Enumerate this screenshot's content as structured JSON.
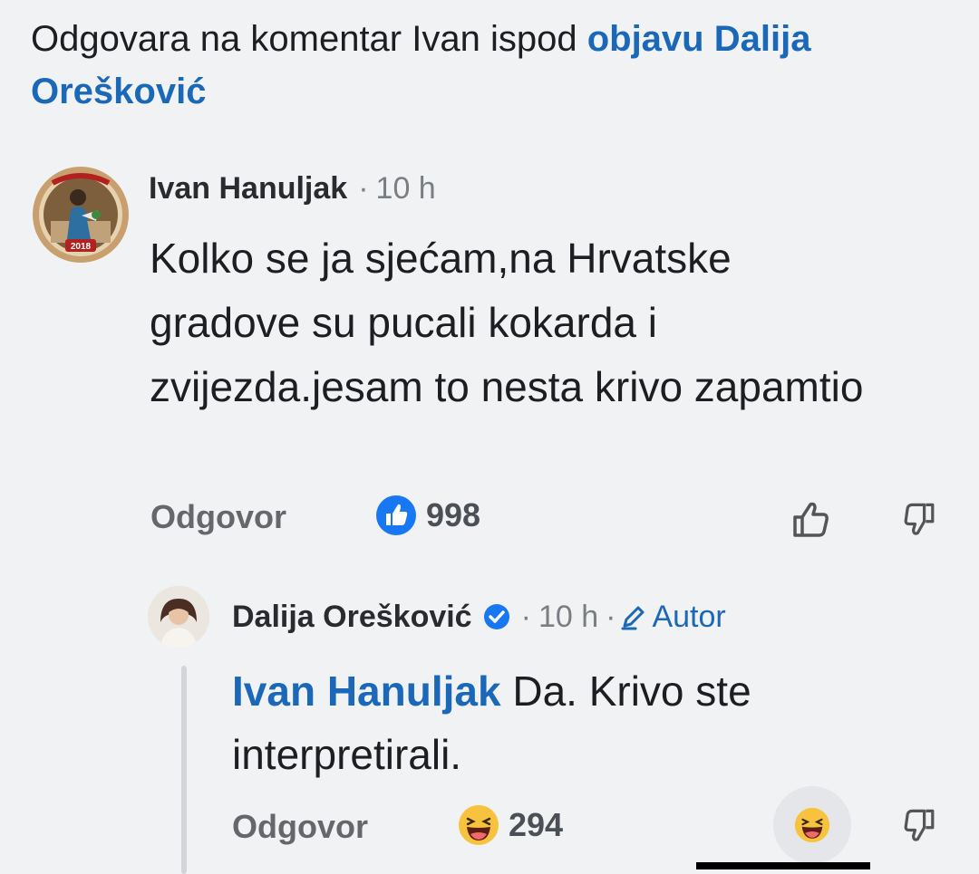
{
  "header": {
    "prefix": "Odgovara na komentar Ivan ispod ",
    "link": "objavu Dalija Orešković"
  },
  "comment": {
    "author": "Ivan Hanuljak",
    "separator": "·",
    "time": "10 h",
    "avatar_badge": "2018",
    "text": "Kolko se ja sjećam,na Hrvatske gradove su pucali kokarda i zvijezda.jesam to nesta krivo zapamtio",
    "reply_label": "Odgovor",
    "reaction_icon": "like-icon",
    "reaction_count": "998",
    "reaction_color": "#1877f2"
  },
  "reply": {
    "author": "Dalija Orešković",
    "verified_icon": "verified-badge-icon",
    "separator": "·",
    "time": "10 h",
    "separator2": "·",
    "author_badge": "Autor",
    "mention": "Ivan Hanuljak",
    "text": " Da. Krivo ste interpretirali.",
    "reply_label": "Odgovor",
    "reaction_icon": "haha-icon",
    "reaction_count": "294"
  },
  "colors": {
    "link": "#1b68b8",
    "background": "#f1f2f4",
    "muted": "#65676b"
  }
}
